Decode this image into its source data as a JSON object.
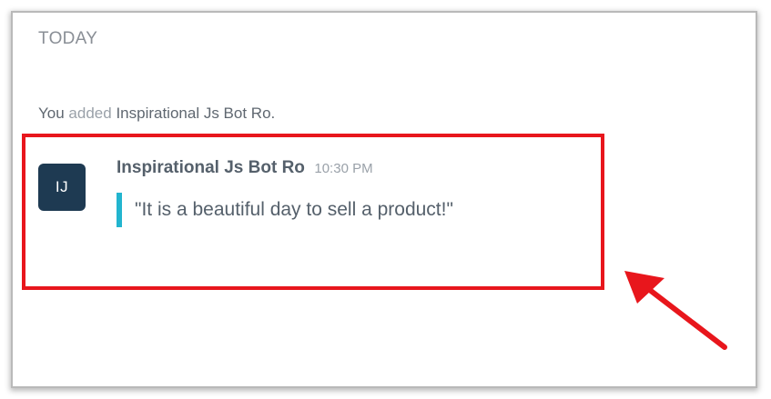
{
  "day_divider": "TODAY",
  "system_message": {
    "actor": "You",
    "action": "added",
    "target": "Inspirational Js Bot Ro."
  },
  "message": {
    "avatar_initials": "IJ",
    "author": "Inspirational Js Bot Ro",
    "time": "10:30 PM",
    "quote": "\"It is a beautiful day to sell a product!\""
  },
  "colors": {
    "avatar_bg": "#1e3a52",
    "quote_bar": "#22b5cf",
    "annotation_red": "#e8161c"
  },
  "icons": {
    "annotation_arrow": "red-arrow-icon"
  }
}
